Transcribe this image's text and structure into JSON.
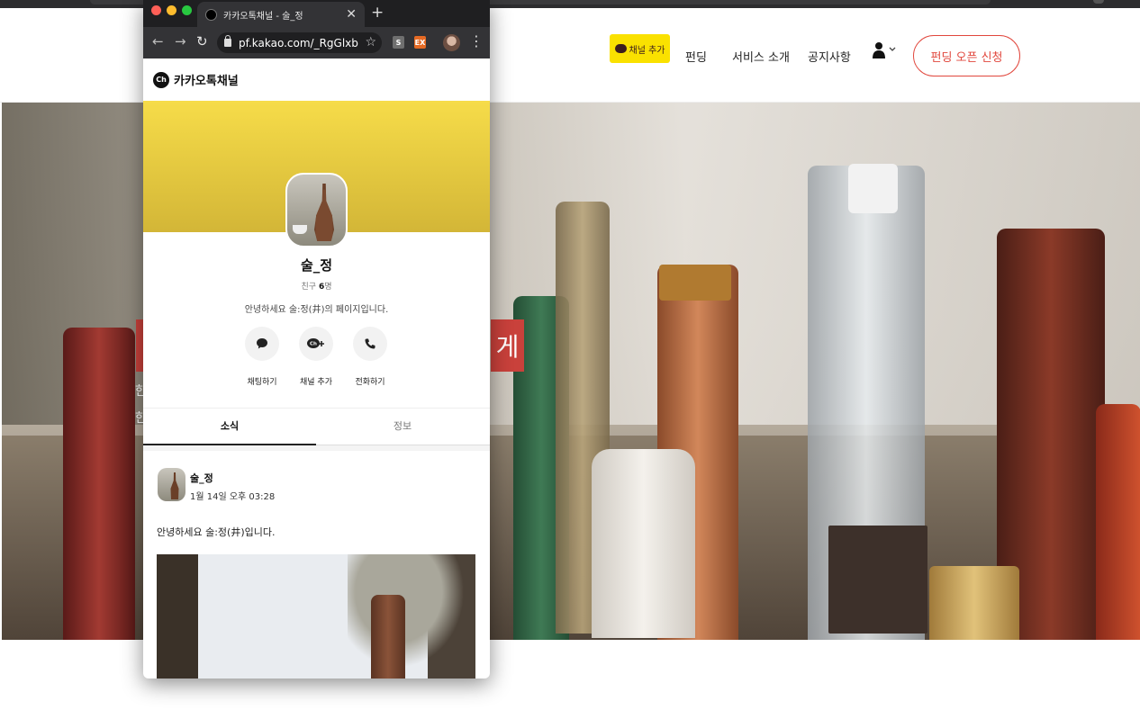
{
  "site": {
    "nav": {
      "channel_add_label": "채널 추가",
      "funding": "펀딩",
      "service_intro": "서비스 소개",
      "notice": "공지사항",
      "open_funding_button": "펀딩 오픈 신청"
    },
    "hero": {
      "badge_text": "게",
      "side_text_1": "한",
      "side_text_2": "한"
    }
  },
  "browser": {
    "tab_title": "카카오톡채널 - 술_정",
    "url": "pf.kakao.com/_RgGlxb",
    "extensions": [
      {
        "label": "S",
        "color": "#6f6f6f"
      },
      {
        "label": "EX",
        "color": "#e56a24"
      }
    ]
  },
  "channel": {
    "header_title": "카카오톡채널",
    "logo_text": "Ch",
    "name": "술_정",
    "friends_label": "친구",
    "friends_count": "6",
    "friends_unit": "명",
    "description": "안녕하세요 술:정(井)의 페이지입니다.",
    "actions": [
      {
        "icon": "chat-bubble-icon",
        "label": "채팅하기"
      },
      {
        "icon": "channel-add-icon",
        "label": "채널 추가"
      },
      {
        "icon": "phone-icon",
        "label": "전화하기"
      }
    ],
    "tabs": [
      {
        "label": "소식",
        "active": true
      },
      {
        "label": "정보",
        "active": false
      }
    ],
    "post": {
      "author": "술_정",
      "time": "1월 14일 오후 03:28",
      "text": "안녕하세요 술:정(井)입니다."
    }
  },
  "colors": {
    "kakao_yellow": "#fae100",
    "accent_red": "#e1473d"
  }
}
